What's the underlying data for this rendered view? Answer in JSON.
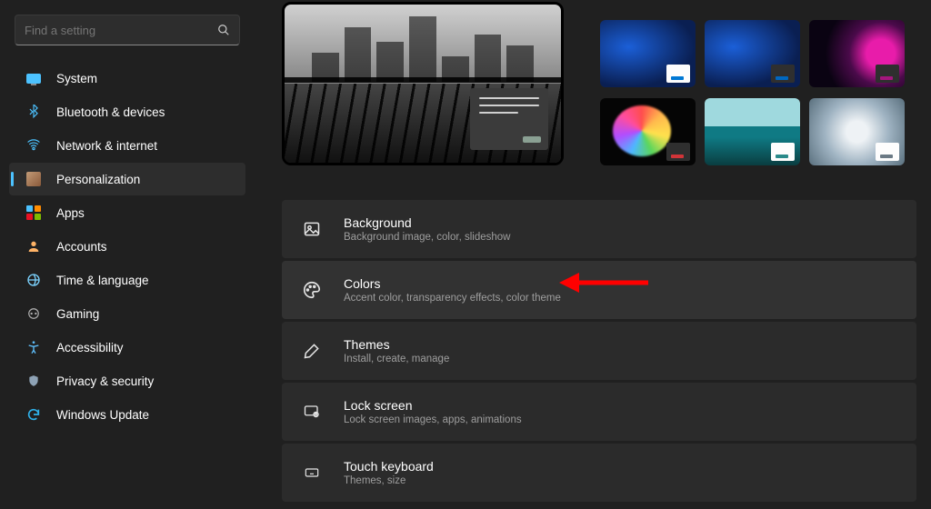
{
  "search": {
    "placeholder": "Find a setting"
  },
  "nav": [
    {
      "label": "System"
    },
    {
      "label": "Bluetooth & devices"
    },
    {
      "label": "Network & internet"
    },
    {
      "label": "Personalization"
    },
    {
      "label": "Apps"
    },
    {
      "label": "Accounts"
    },
    {
      "label": "Time & language"
    },
    {
      "label": "Gaming"
    },
    {
      "label": "Accessibility"
    },
    {
      "label": "Privacy & security"
    },
    {
      "label": "Windows Update"
    }
  ],
  "cards": [
    {
      "title": "Background",
      "sub": "Background image, color, slideshow"
    },
    {
      "title": "Colors",
      "sub": "Accent color, transparency effects, color theme"
    },
    {
      "title": "Themes",
      "sub": "Install, create, manage"
    },
    {
      "title": "Lock screen",
      "sub": "Lock screen images, apps, animations"
    },
    {
      "title": "Touch keyboard",
      "sub": "Themes, size"
    }
  ]
}
